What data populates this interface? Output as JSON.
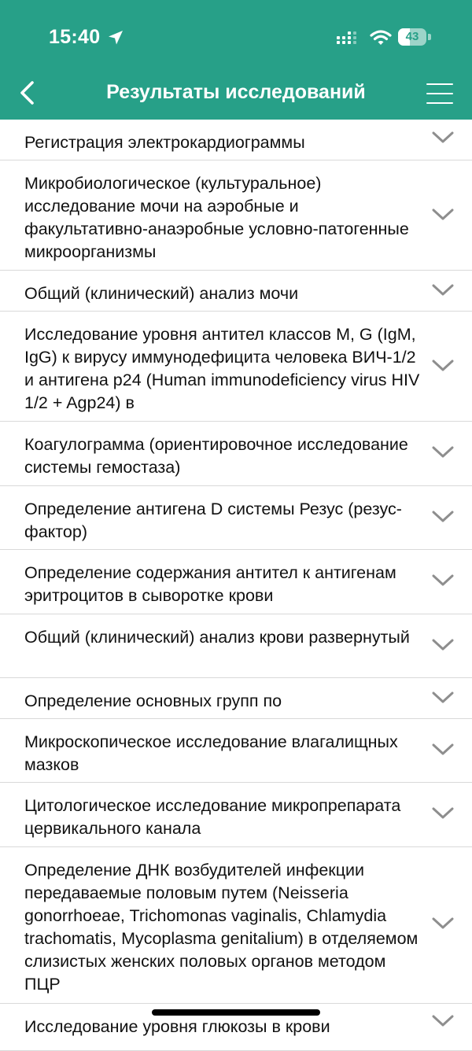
{
  "status_bar": {
    "time": "15:40",
    "battery": {
      "level_percent": 43,
      "label": "43"
    }
  },
  "header": {
    "title": "Результаты исследований"
  },
  "results": [
    {
      "title": "Регистрация электрокардиограммы"
    },
    {
      "title": "Микробиологическое (культуральное) исследование мочи на аэробные и факультативно-анаэробные условно-патогенные микроорганизмы"
    },
    {
      "title": "Общий (клинический) анализ мочи"
    },
    {
      "title": "Исследование уровня антител классов M, G (IgM, IgG) к вирусу иммунодефицита человека ВИЧ-1/2 и антигена p24 (Human immunodeficiency virus HIV 1/2 + Agp24) в"
    },
    {
      "title": "Коагулограмма (ориентировочное исследование системы гемостаза)"
    },
    {
      "title": "Определение антигена D системы Резус (резус-фактор)"
    },
    {
      "title": "Определение содержания антител к антигенам эритроцитов в сыворотке крови"
    },
    {
      "title": "Общий (клинический) анализ крови развернутый"
    },
    {
      "title": "Определение основных групп по"
    },
    {
      "title": "Микроскопическое исследование влагалищных мазков"
    },
    {
      "title": "Цитологическое исследование микропрепарата цервикального канала"
    },
    {
      "title": "Определение ДНК возбудителей инфекции передаваемые половым путем (Neisseria gonorrhoeae, Trichomonas vaginalis, Chlamydia trachomatis, Mycoplasma genitalium) в отделяемом слизистых женских половых органов методом ПЦР"
    },
    {
      "title": "Исследование уровня глюкозы в крови"
    }
  ]
}
